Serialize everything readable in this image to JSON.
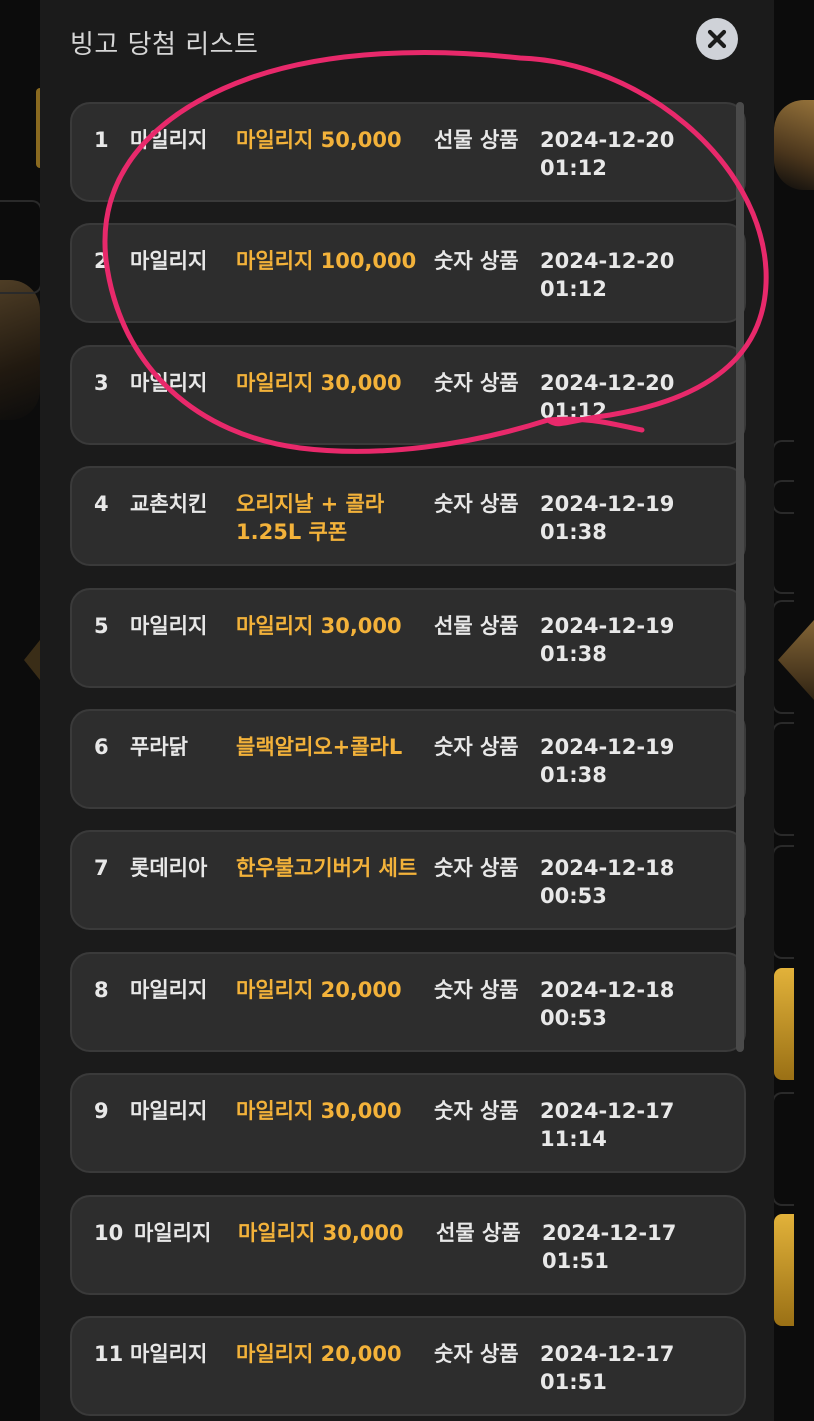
{
  "modal": {
    "title": "빙고 당첨 리스트",
    "close_icon": "close-icon"
  },
  "rows": [
    {
      "rank": "1",
      "brand": "마일리지",
      "prize": "마일리지 50,000",
      "type": "선물 상품",
      "date": "2024-12-20",
      "time": "01:12"
    },
    {
      "rank": "2",
      "brand": "마일리지",
      "prize": "마일리지 100,000",
      "type": "숫자 상품",
      "date": "2024-12-20",
      "time": "01:12"
    },
    {
      "rank": "3",
      "brand": "마일리지",
      "prize": "마일리지 30,000",
      "type": "숫자 상품",
      "date": "2024-12-20",
      "time": "01:12"
    },
    {
      "rank": "4",
      "brand": "교촌치킨",
      "prize": "오리지날 + 콜라 1.25L 쿠폰",
      "type": "숫자 상품",
      "date": "2024-12-19",
      "time": "01:38"
    },
    {
      "rank": "5",
      "brand": "마일리지",
      "prize": "마일리지 30,000",
      "type": "선물 상품",
      "date": "2024-12-19",
      "time": "01:38"
    },
    {
      "rank": "6",
      "brand": "푸라닭",
      "prize": "블랙알리오+콜라L",
      "type": "숫자 상품",
      "date": "2024-12-19",
      "time": "01:38"
    },
    {
      "rank": "7",
      "brand": "롯데리아",
      "prize": "한우불고기버거 세트",
      "type": "숫자 상품",
      "date": "2024-12-18",
      "time": "00:53"
    },
    {
      "rank": "8",
      "brand": "마일리지",
      "prize": "마일리지 20,000",
      "type": "숫자 상품",
      "date": "2024-12-18",
      "time": "00:53"
    },
    {
      "rank": "9",
      "brand": "마일리지",
      "prize": "마일리지 30,000",
      "type": "숫자 상품",
      "date": "2024-12-17",
      "time": "11:14"
    },
    {
      "rank": "10",
      "brand": "마일리지",
      "prize": "마일리지 30,000",
      "type": "선물 상품",
      "date": "2024-12-17",
      "time": "01:51"
    },
    {
      "rank": "11",
      "brand": "마일리지",
      "prize": "마일리지 20,000",
      "type": "숫자 상품",
      "date": "2024-12-17",
      "time": "01:51"
    }
  ],
  "colors": {
    "modal_bg": "#1b1b1b",
    "row_bg": "#2d2d2d",
    "prize_text": "#f3b23a",
    "annotation": "#e8296b"
  }
}
